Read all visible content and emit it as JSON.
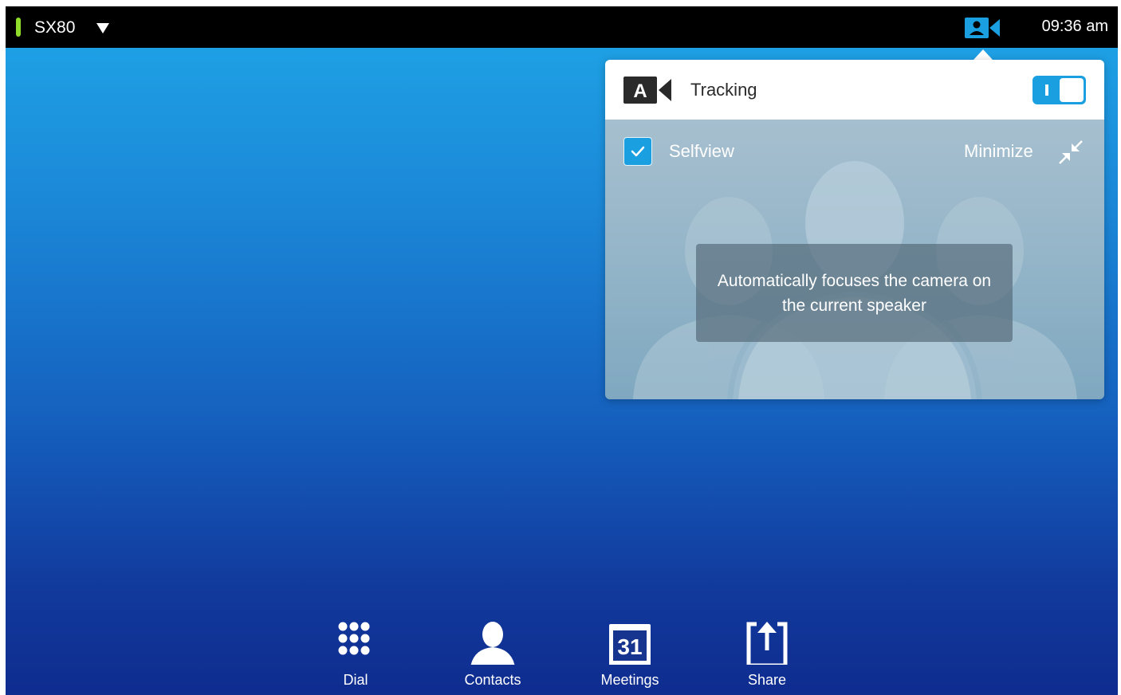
{
  "status_bar": {
    "device_name": "SX80",
    "status_color": "#8fdc2a",
    "camera_icon": "camera-icon",
    "clock": "09:36 am"
  },
  "camera_panel": {
    "tracking": {
      "icon_letter": "A",
      "label": "Tracking",
      "enabled": true
    },
    "selfview": {
      "label": "Selfview",
      "checked": true
    },
    "minimize": {
      "label": "Minimize",
      "icon": "minimize-icon"
    },
    "tooltip": "Automatically focuses the camera on the current speaker"
  },
  "bottom_nav": [
    {
      "label": "Dial",
      "icon": "dialpad-icon"
    },
    {
      "label": "Contacts",
      "icon": "contacts-icon"
    },
    {
      "label": "Meetings",
      "icon": "calendar-icon",
      "icon_text": "31"
    },
    {
      "label": "Share",
      "icon": "share-icon"
    }
  ],
  "colors": {
    "accent": "#1a9fe0",
    "topbar": "#000000",
    "background_top": "#1fa6e8",
    "background_bottom": "#0f2c8f"
  }
}
